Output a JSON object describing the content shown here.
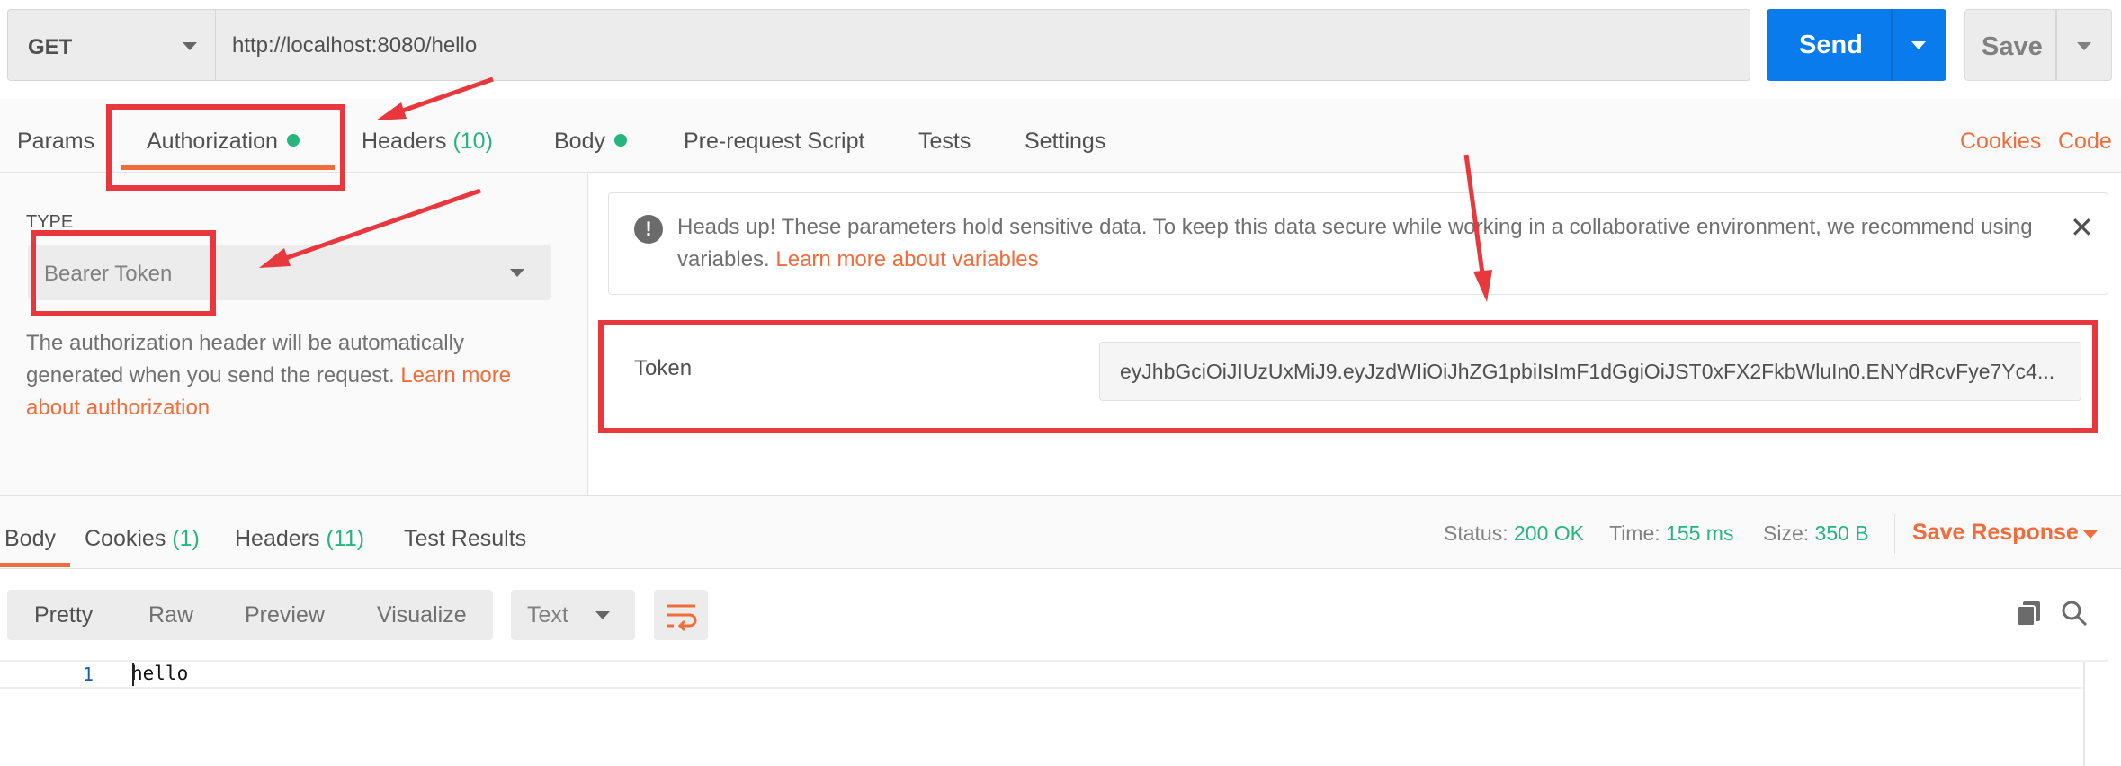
{
  "request": {
    "method": "GET",
    "url": "http://localhost:8080/hello",
    "send_label": "Send",
    "save_label": "Save"
  },
  "request_tabs": {
    "params": "Params",
    "authorization": "Authorization",
    "headers": "Headers",
    "headers_count": "(10)",
    "body": "Body",
    "prerequest": "Pre-request Script",
    "tests": "Tests",
    "settings": "Settings",
    "cookies": "Cookies",
    "code": "Code"
  },
  "auth": {
    "type_label": "TYPE",
    "type_value": "Bearer Token",
    "description": "The authorization header will be automatically generated when you send the request.",
    "learn_more": "Learn more about authorization"
  },
  "notice": {
    "text": "Heads up! These parameters hold sensitive data. To keep this data secure while working in a collaborative environment, we recommend using variables.",
    "link": "Learn more about variables"
  },
  "token": {
    "label": "Token",
    "value": "eyJhbGciOiJIUzUxMiJ9.eyJzdWIiOiJhZG1pbiIsImF1dGgiOiJST0xFX2FkbWluIn0.ENYdRcvFye7Yc4..."
  },
  "response_tabs": {
    "body": "Body",
    "cookies": "Cookies",
    "cookies_count": "(1)",
    "headers": "Headers",
    "headers_count": "(11)",
    "test_results": "Test Results"
  },
  "response_status": {
    "status_label": "Status:",
    "status_value": "200 OK",
    "time_label": "Time:",
    "time_value": "155 ms",
    "size_label": "Size:",
    "size_value": "350 B",
    "save_response": "Save Response"
  },
  "response_view": {
    "pretty": "Pretty",
    "raw": "Raw",
    "preview": "Preview",
    "visualize": "Visualize",
    "format": "Text"
  },
  "response_body": {
    "line_number": "1",
    "content": "hello"
  },
  "colors": {
    "accent_blue": "#097bed",
    "accent_orange": "#f26b3a",
    "success_green": "#26b47f",
    "annotation_red": "#e8373d"
  }
}
